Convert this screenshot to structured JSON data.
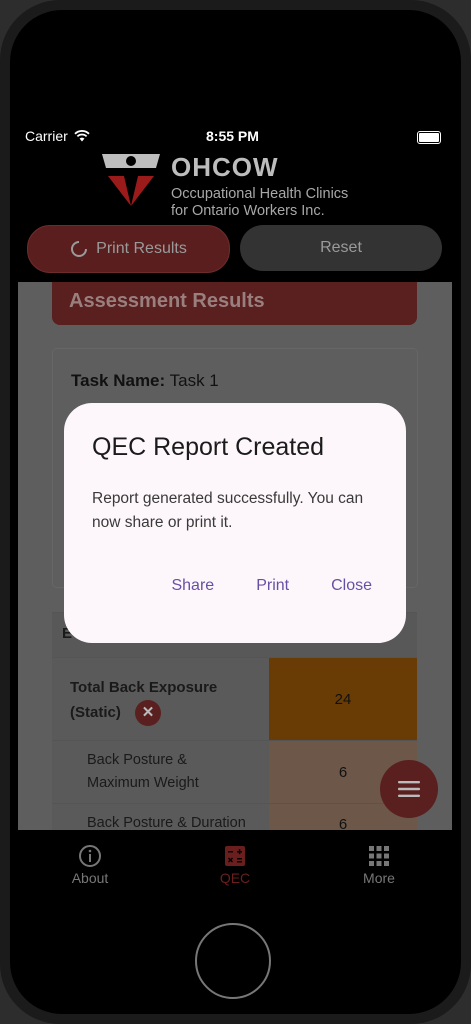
{
  "status": {
    "carrier": "Carrier",
    "time": "8:55 PM"
  },
  "logo": {
    "title": "OHCOW",
    "subtitle_line1": "Occupational Health Clinics",
    "subtitle_line2": "for Ontario Workers Inc."
  },
  "actions": {
    "print_label": "Print Results",
    "reset_label": "Reset"
  },
  "results": {
    "header": "Assessment Results",
    "task_label": "Task Name:",
    "task_value": "Task 1",
    "table": {
      "header_left": "E",
      "rows": [
        {
          "label_line1": "Total Back Exposure",
          "label_line2": "(Static)",
          "value": "24"
        },
        {
          "label": "Back Posture & Maximum Weight",
          "value": "6"
        },
        {
          "label": "Back Posture & Duration",
          "value": "6"
        }
      ]
    }
  },
  "dialog": {
    "title": "QEC Report Created",
    "message": "Report generated successfully. You can now share or print it.",
    "share": "Share",
    "print": "Print",
    "close": "Close"
  },
  "tabs": {
    "about": "About",
    "qec": "QEC",
    "more": "More"
  },
  "colors": {
    "accent": "#a7282a",
    "dialog_action": "#6750a4",
    "exposure_high": "#e07a10",
    "exposure_med": "#f3ba8f"
  }
}
